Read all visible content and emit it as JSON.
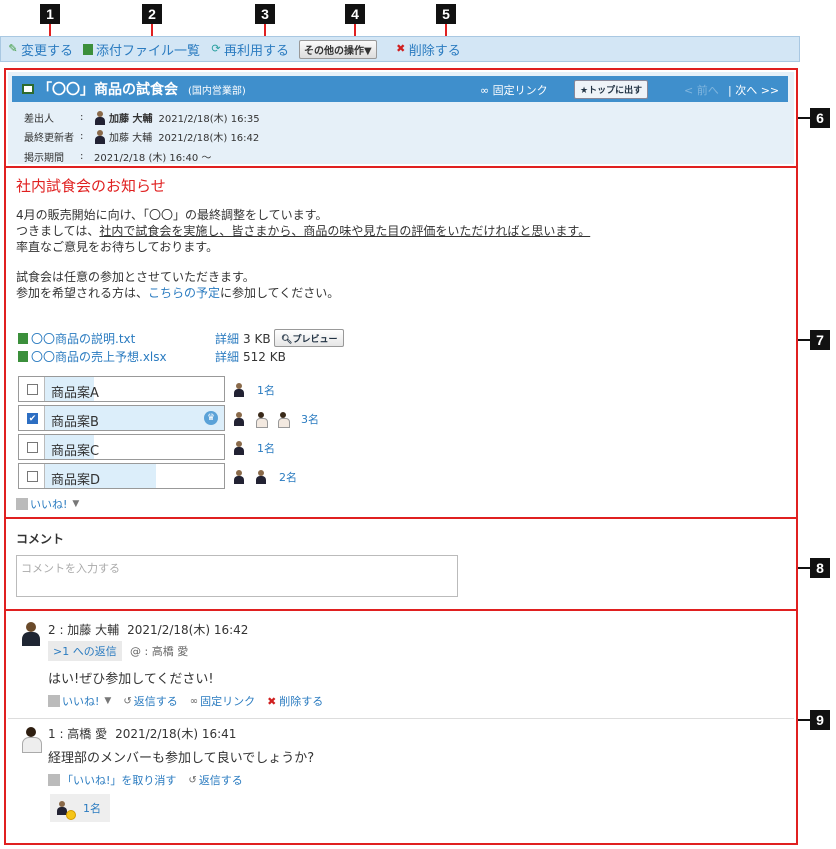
{
  "markers": [
    "1",
    "2",
    "3",
    "4",
    "5",
    "6",
    "7",
    "8",
    "9"
  ],
  "toolbar": {
    "edit": "変更する",
    "attachments": "添付ファイル一覧",
    "reuse": "再利用する",
    "other_ops": "その他の操作▼",
    "delete": "削除する"
  },
  "header": {
    "title": "「〇〇」商品の試食会",
    "dept": "(国内営業部)",
    "permalink": "固定リンク",
    "to_top": "トップに出す",
    "prev": "< 前へ",
    "next": "| 次へ >>",
    "sender_label": "差出人",
    "sender_name": "加藤 大輔",
    "sender_date": "2021/2/18(木) 16:35",
    "updater_label": "最終更新者",
    "updater_name": "加藤 大輔",
    "updater_date": "2021/2/18(木) 16:42",
    "period_label": "掲示期間",
    "period_value": "2021/2/18 (木) 16:40 〜",
    "colon": ":"
  },
  "body": {
    "notice_title": "社内試食会のお知らせ",
    "line1": "4月の販売開始に向け、「〇〇」の最終調整をしています。",
    "line2a": "つきましては、",
    "line2b": "社内で試食会を実施し、皆さまから、商品の味や見た目の評価をいただければと思います。",
    "line3": "率直なご意見をお待ちしております。",
    "line4": "試食会は任意の参加とさせていただきます。",
    "line5a": "参加を希望される方は、",
    "line5b": "こちらの予定",
    "line5c": "に参加してください。"
  },
  "files": [
    {
      "name": "〇〇商品の説明.txt",
      "detail": "詳細",
      "size": "3 KB"
    },
    {
      "name": "〇〇商品の売上予想.xlsx",
      "detail": "詳細",
      "size": "512 KB"
    }
  ],
  "preview": "プレビュー",
  "votes": [
    {
      "label": "商品案A",
      "checked": false,
      "ratio": 0.28,
      "count": "1名"
    },
    {
      "label": "商品案B",
      "checked": true,
      "ratio": 1.0,
      "count": "3名"
    },
    {
      "label": "商品案C",
      "checked": false,
      "ratio": 0.28,
      "count": "1名"
    },
    {
      "label": "商品案D",
      "checked": false,
      "ratio": 0.62,
      "count": "2名"
    }
  ],
  "like_label": "いいね!",
  "comment": {
    "title": "コメント",
    "placeholder": "コメントを入力する"
  },
  "replies": [
    {
      "head": "2 : 加藤 大輔",
      "date": "2021/2/18(木) 16:42",
      "reply_to": ">1 への返信",
      "mention": "@ : 高橋 愛",
      "text": "はい!ぜひ参加してください!",
      "like": "いいね!",
      "reply": "返信する",
      "permalink": "固定リンク",
      "delete": "削除する"
    },
    {
      "head": "1 : 高橋 愛",
      "date": "2021/2/18(木) 16:41",
      "text": "経理部のメンバーも参加して良いでしょうか?",
      "unlike": "「いいね!」を取り消す",
      "reply": "返信する",
      "likers_count": "1名"
    }
  ]
}
